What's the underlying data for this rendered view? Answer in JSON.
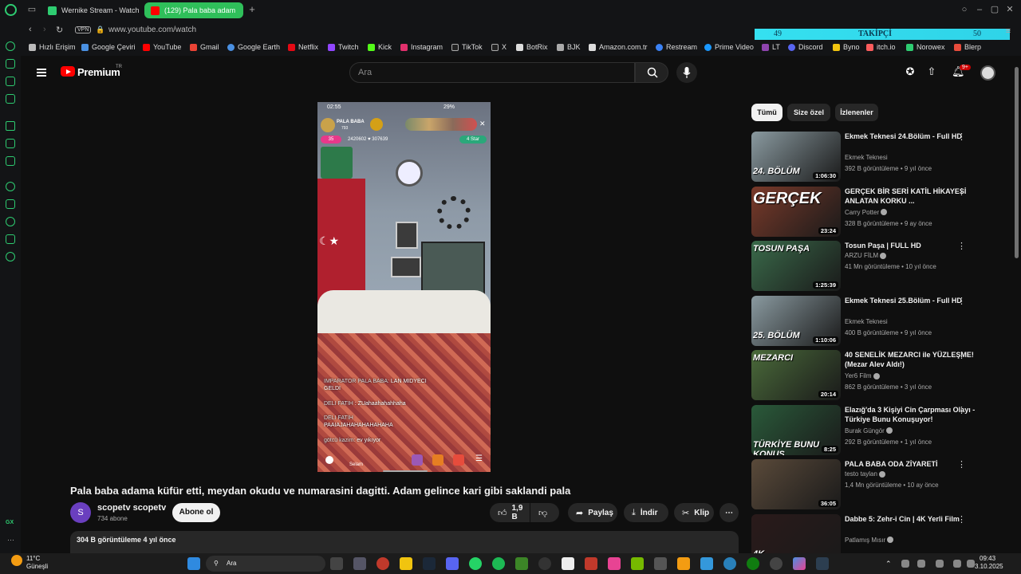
{
  "browser": {
    "tabs": [
      {
        "label": "Wernike Stream - Watch l",
        "active": false
      },
      {
        "label": "(129) Pala baba adam",
        "active": true
      }
    ],
    "address": {
      "vpn": "VPN",
      "url": "www.youtube.com/watch"
    },
    "overlay": {
      "left": "49",
      "center": "TAKİPÇİ",
      "right": "50"
    },
    "bookmarks": [
      "Hızlı Erişim",
      "Google Çeviri",
      "YouTube",
      "Gmail",
      "Google Earth",
      "Netflix",
      "Twitch",
      "Kick",
      "Instagram",
      "TikTok",
      "X",
      "BotRix",
      "BJK",
      "Amazon.com.tr",
      "Restream",
      "Prime Video",
      "LT",
      "Discord",
      "Byno",
      "itch.io",
      "Norowex",
      "Blerp"
    ],
    "sidebar_bottom": "GX"
  },
  "youtube": {
    "logo": "Premium",
    "region": "TR",
    "search_placeholder": "Ara",
    "notifications": "9+",
    "video": {
      "title": "Pala baba adama küfür etti, meydan okudu ve numarasini dagitti. Adam gelince kari gibi saklandi pala",
      "channel": "scopetv scopetv",
      "channel_initial": "S",
      "subscribers": "734 abone",
      "subscribe_label": "Abone ol",
      "likes": "1,9 B",
      "share": "Paylaş",
      "download": "İndir",
      "clip": "Klip",
      "views_time": "304 B görüntüleme  4 yıl önce"
    },
    "stream_overlay": {
      "time": "02:55",
      "battery": "29%",
      "streamer": "PALA BABA",
      "streamer_sub": "793",
      "level": "35",
      "stat1": "2420602",
      "stat2": "307639",
      "star": "4 Star",
      "chat": [
        {
          "user": "IMPARATOR PALA BABA:",
          "msg": "LAN MIDYECI GELDI"
        },
        {
          "user": "DELI FATIH",
          "msg": "ZUahaahahahhaha"
        },
        {
          "user": "DELI FATIH",
          "msg": "PAAIAJAHAHAHAHAHAHA"
        },
        {
          "user": "götcü kazim:",
          "msg": "ev yıkıyor"
        }
      ],
      "bottom_label": "Selam"
    },
    "chips": [
      "Tümü",
      "Size özel",
      "İzlenenler"
    ],
    "recommendations": [
      {
        "title": "Ekmek Teknesi 24.Bölüm - Full HD",
        "channel": "Ekmek Teknesi",
        "verified": false,
        "meta": "392 B görüntüleme • 9 yıl önce",
        "duration": "1:06:30",
        "thumb_text": "24. BÖLÜM",
        "thumb_color": "#8a9aa0"
      },
      {
        "title": "GERÇEK BİR SERİ KATİL HİKAYESİ ANLATAN KORKU ...",
        "channel": "Carry Potter",
        "verified": true,
        "meta": "328 B görüntüleme • 9 ay önce",
        "duration": "23:24",
        "thumb_text": "GERÇEK",
        "thumb_color": "#7a3a2a"
      },
      {
        "title": "Tosun Paşa | FULL HD",
        "channel": "ARZU FİLM",
        "verified": true,
        "meta": "41 Mn görüntüleme • 10 yıl önce",
        "duration": "1:25:39",
        "thumb_text": "TOSUN PAŞA",
        "thumb_color": "#3a6a4a"
      },
      {
        "title": "Ekmek Teknesi 25.Bölüm - Full HD",
        "channel": "Ekmek Teknesi",
        "verified": false,
        "meta": "400 B görüntüleme • 9 yıl önce",
        "duration": "1:10:06",
        "thumb_text": "25. BÖLÜM",
        "thumb_color": "#8a9aa0"
      },
      {
        "title": "40 SENELİK MEZARCI ile YÜZLEŞME! (Mezar Alev Aldı!)",
        "channel": "Yer6 Film",
        "verified": true,
        "meta": "862 B görüntüleme • 3 yıl önce",
        "duration": "20:14",
        "thumb_text": "MEZARCI",
        "thumb_color": "#4a6a3a"
      },
      {
        "title": "Elazığ'da 3 Kişiyi Cin Çarpması Olayı - Türkiye Bunu Konuşuyor!",
        "channel": "Burak Güngör",
        "verified": true,
        "meta": "292 B görüntüleme • 1 yıl önce",
        "duration": "8:25",
        "thumb_text": "TÜRKİYE BUNU KONUŞ",
        "thumb_color": "#2a5a3a"
      },
      {
        "title": "PALA BABA ODA ZİYARETİ",
        "channel": "testo taylan",
        "verified": true,
        "meta": "1,4 Mn görüntüleme • 10 ay önce",
        "duration": "36:05",
        "thumb_text": "",
        "thumb_color": "#5a4a3a"
      },
      {
        "title": "Dabbe 5: Zehr-i Cin | 4K Yerli Film",
        "channel": "Patlamış Mısır",
        "verified": true,
        "meta": "",
        "duration": "",
        "thumb_text": "4K",
        "thumb_color": "#2a1a1a"
      }
    ]
  },
  "taskbar": {
    "temp": "11°C",
    "weather": "Güneşli",
    "search": "Ara",
    "time": "09:43",
    "date": "3.10.2025"
  }
}
